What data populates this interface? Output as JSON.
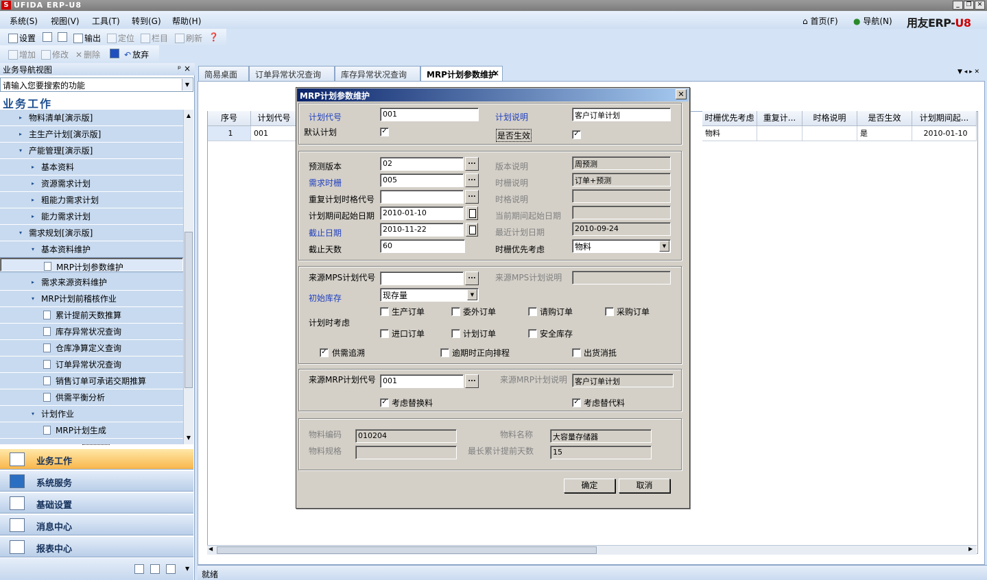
{
  "window": {
    "title": "UFIDA ERP-U8",
    "logo": "S"
  },
  "menu": [
    "系统(S)",
    "视图(V)",
    "工具(T)",
    "转到(G)",
    "帮助(H)"
  ],
  "topright": {
    "home": "首页(F)",
    "nav": "导航(N)",
    "brand_a": "用友ERP-",
    "brand_b": "U8"
  },
  "toolbar1": {
    "settings": "设置",
    "print": "",
    "preview": "",
    "output": "输出",
    "locate": "定位",
    "columns": "栏目",
    "refresh": "刷新"
  },
  "toolbar2": {
    "add": "增加",
    "edit": "修改",
    "delete": "删除",
    "save": "",
    "discard": "放弃"
  },
  "nav": {
    "header": "业务导航视图",
    "pin": "ᵖ ×",
    "search_placeholder": "请输入您要搜索的功能",
    "section": "业务工作",
    "items": [
      {
        "label": "物料清单[演示版]",
        "level": 1,
        "arrow": "▸"
      },
      {
        "label": "主生产计划[演示版]",
        "level": 1,
        "arrow": "▸"
      },
      {
        "label": "产能管理[演示版]",
        "level": 1,
        "arrow": "▾"
      },
      {
        "label": "基本资料",
        "level": 2,
        "arrow": "▸"
      },
      {
        "label": "资源需求计划",
        "level": 2,
        "arrow": "▸"
      },
      {
        "label": "粗能力需求计划",
        "level": 2,
        "arrow": "▸"
      },
      {
        "label": "能力需求计划",
        "level": 2,
        "arrow": "▸"
      },
      {
        "label": "需求规划[演示版]",
        "level": 1,
        "arrow": "▾"
      },
      {
        "label": "基本资料维护",
        "level": 2,
        "arrow": "▾"
      },
      {
        "label": "MRP计划参数维护",
        "level": 3,
        "arrow": "",
        "selected": true
      },
      {
        "label": "需求来源资料维护",
        "level": 2,
        "arrow": "▸"
      },
      {
        "label": "MRP计划前稽核作业",
        "level": 2,
        "arrow": "▾"
      },
      {
        "label": "累计提前天数推算",
        "level": 3,
        "arrow": ""
      },
      {
        "label": "库存异常状况查询",
        "level": 3,
        "arrow": ""
      },
      {
        "label": "仓库净算定义查询",
        "level": 3,
        "arrow": ""
      },
      {
        "label": "订单异常状况查询",
        "level": 3,
        "arrow": ""
      },
      {
        "label": "销售订单可承诺交期推算",
        "level": 3,
        "arrow": ""
      },
      {
        "label": "供需平衡分析",
        "level": 3,
        "arrow": ""
      },
      {
        "label": "计划作业",
        "level": 2,
        "arrow": "▾"
      },
      {
        "label": "MRP计划生成",
        "level": 3,
        "arrow": ""
      }
    ],
    "modules": [
      "业务工作",
      "系统服务",
      "基础设置",
      "消息中心",
      "报表中心"
    ]
  },
  "tabs": [
    "简易桌面",
    "订单异常状况查询",
    "库存异常状况查询",
    "MRP计划参数维护"
  ],
  "grid": {
    "headers_left": [
      "序号",
      "计划代号"
    ],
    "headers_right": [
      "时栅优先考虑",
      "重复计...",
      "时格说明",
      "是否生效",
      "计划期间起..."
    ],
    "row_left": [
      "1",
      "001"
    ],
    "row_right": [
      "物料",
      "",
      "",
      "是",
      "2010-01-10"
    ]
  },
  "status": "就绪",
  "dialog": {
    "title": "MRP计划参数维护",
    "plan_code_label": "计划代号",
    "plan_code": "001",
    "plan_desc_label": "计划说明",
    "plan_desc": "客户订单计划",
    "default_label": "默认计划",
    "active_label": "是否生效",
    "forecast_label": "预测版本",
    "forecast": "02",
    "ver_desc_label": "版本说明",
    "ver_desc": "周预测",
    "demand_label": "需求时栅",
    "demand": "005",
    "tf_desc_label": "时栅说明",
    "tf_desc": "订单+预测",
    "repeat_label": "重复计划时格代号",
    "repeat": "",
    "tg_desc_label": "时格说明",
    "tg_desc": "",
    "start_label": "计划期间起始日期",
    "start": "2010-01-10",
    "cur_start_label": "当前期间起始日期",
    "cur_start": "",
    "end_label": "截止日期",
    "end": "2010-11-22",
    "last_label": "最近计划日期",
    "last": "2010-09-24",
    "days_label": "截止天数",
    "days": "60",
    "prio_label": "时栅优先考虑",
    "prio": "物料",
    "mps_label": "来源MPS计划代号",
    "mps": "",
    "mps_desc_label": "来源MPS计划说明",
    "mps_desc": "",
    "init_label": "初始库存",
    "init": "现存量",
    "consider_label": "计划时考虑",
    "opts": [
      "生产订单",
      "委外订单",
      "请购订单",
      "采购订单",
      "进口订单",
      "计划订单",
      "安全库存"
    ],
    "trace": "供需追溯",
    "overdue": "逾期时正向排程",
    "ship": "出货消抵",
    "mrp_label": "来源MRP计划代号",
    "mrp": "001",
    "mrp_desc_label": "来源MRP计划说明",
    "mrp_desc": "客户订单计划",
    "sub1": "考虑替换料",
    "sub2": "考虑替代料",
    "item_code_label": "物料编码",
    "item_code": "010204",
    "item_name_label": "物料名称",
    "item_name": "大容量存储器",
    "spec_label": "物料规格",
    "spec": "",
    "lead_label": "最长累计提前天数",
    "lead": "15",
    "ok": "确定",
    "cancel": "取消",
    "check": "✓",
    "dots": "...",
    "arrow_down": "▼"
  }
}
